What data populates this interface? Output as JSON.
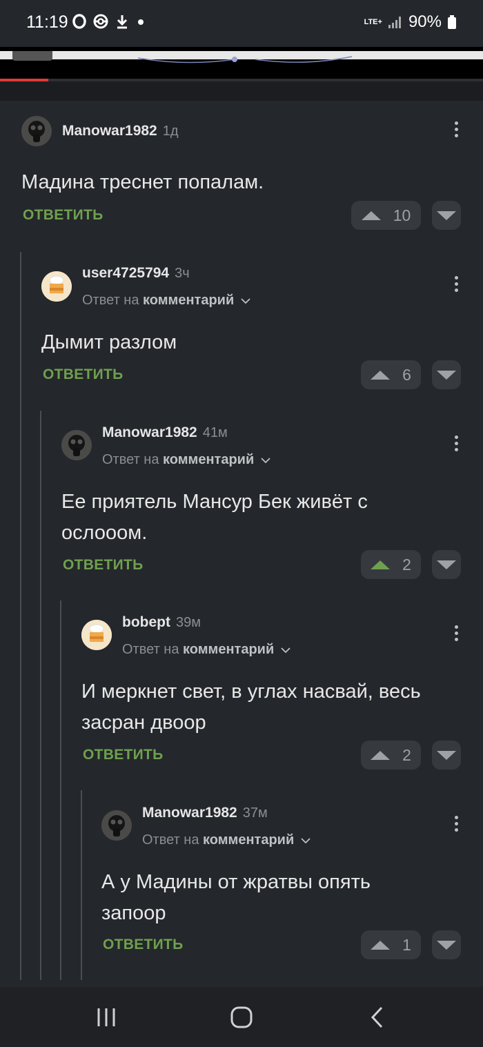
{
  "status_bar": {
    "time": "11:19",
    "network": "LTE+",
    "battery": "90%"
  },
  "media_progress_fraction": 0.1,
  "comments": [
    {
      "username": "Manowar1982",
      "time": "1д",
      "reply_to_prefix": "",
      "reply_to_target": "",
      "text": "Мадина треснет попалам.",
      "reply_label": "ОТВЕТИТЬ",
      "votes": "10",
      "upvoted": false,
      "avatar": "gas-mask"
    },
    {
      "username": "user4725794",
      "time": "3ч",
      "reply_to_prefix": "Ответ на",
      "reply_to_target": "комментарий",
      "text": "Дымит разлом",
      "reply_label": "ОТВЕТИТЬ",
      "votes": "6",
      "upvoted": false,
      "avatar": "cook"
    },
    {
      "username": "Manowar1982",
      "time": "41м",
      "reply_to_prefix": "Ответ на",
      "reply_to_target": "комментарий",
      "text": "Ее приятель Мансур Бек живёт с ослооом.",
      "reply_label": "ОТВЕТИТЬ",
      "votes": "2",
      "upvoted": true,
      "avatar": "gas-mask"
    },
    {
      "username": "bobept",
      "time": "39м",
      "reply_to_prefix": "Ответ на",
      "reply_to_target": "комментарий",
      "text": "И меркнет свет, в углах насвай, весь засран двоор",
      "reply_label": "ОТВЕТИТЬ",
      "votes": "2",
      "upvoted": false,
      "avatar": "cook"
    },
    {
      "username": "Manowar1982",
      "time": "37м",
      "reply_to_prefix": "Ответ на",
      "reply_to_target": "комментарий",
      "text": "А у Мадины от жратвы опять запоор",
      "reply_label": "ОТВЕТИТЬ",
      "votes": "1",
      "upvoted": false,
      "avatar": "gas-mask"
    }
  ],
  "colors": {
    "background": "#24272b",
    "accent_green": "#6fa04f",
    "progress_red": "#e03a3a"
  },
  "nav": {
    "icons": [
      "recent-apps-icon",
      "home-icon",
      "back-icon"
    ]
  }
}
